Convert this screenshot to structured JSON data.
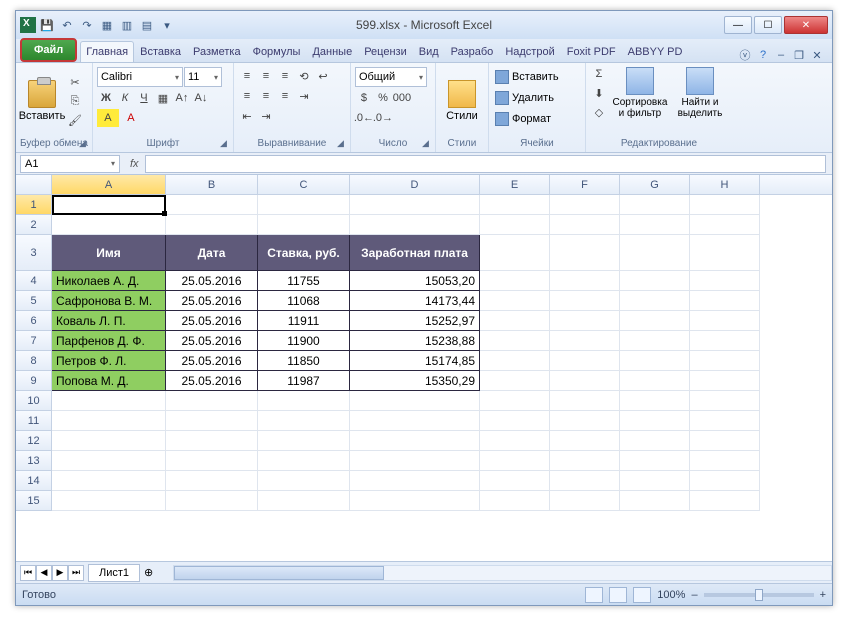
{
  "title": "599.xlsx - Microsoft Excel",
  "tabs": {
    "file": "Файл",
    "list": [
      "Главная",
      "Вставка",
      "Разметка",
      "Формулы",
      "Данные",
      "Рецензи",
      "Вид",
      "Разрабо",
      "Надстрой",
      "Foxit PDF",
      "ABBYY PD"
    ],
    "active": 0
  },
  "ribbon": {
    "clipboard": {
      "paste": "Вставить",
      "label": "Буфер обмена"
    },
    "font": {
      "name": "Calibri",
      "size": "11",
      "label": "Шрифт"
    },
    "alignment": {
      "label": "Выравнивание"
    },
    "number": {
      "format": "Общий",
      "label": "Число"
    },
    "styles": {
      "label": "Стили",
      "btn": "Стили"
    },
    "cells": {
      "insert": "Вставить",
      "delete": "Удалить",
      "format": "Формат",
      "label": "Ячейки"
    },
    "editing": {
      "sort": "Сортировка и фильтр",
      "find": "Найти и выделить",
      "label": "Редактирование"
    }
  },
  "namebox": "A1",
  "columns": [
    "A",
    "B",
    "C",
    "D",
    "E",
    "F",
    "G",
    "H"
  ],
  "colwidths": {
    "A": 114,
    "B": 92,
    "C": 92,
    "D": 130,
    "E": 70,
    "F": 70,
    "G": 70,
    "H": 70
  },
  "headerRow": 3,
  "headers": [
    "Имя",
    "Дата",
    "Ставка, руб.",
    "Заработная плата"
  ],
  "dataRows": [
    {
      "r": 4,
      "name": "Николаев А. Д.",
      "date": "25.05.2016",
      "rate": "11755",
      "salary": "15053,20"
    },
    {
      "r": 5,
      "name": "Сафронова В. М.",
      "date": "25.05.2016",
      "rate": "11068",
      "salary": "14173,44"
    },
    {
      "r": 6,
      "name": "Коваль Л. П.",
      "date": "25.05.2016",
      "rate": "11911",
      "salary": "15252,97"
    },
    {
      "r": 7,
      "name": "Парфенов Д. Ф.",
      "date": "25.05.2016",
      "rate": "11900",
      "salary": "15238,88"
    },
    {
      "r": 8,
      "name": "Петров Ф. Л.",
      "date": "25.05.2016",
      "rate": "11850",
      "salary": "15174,85"
    },
    {
      "r": 9,
      "name": "Попова М. Д.",
      "date": "25.05.2016",
      "rate": "11987",
      "salary": "15350,29"
    }
  ],
  "sheet": "Лист1",
  "status": "Готово",
  "zoom": "100%"
}
